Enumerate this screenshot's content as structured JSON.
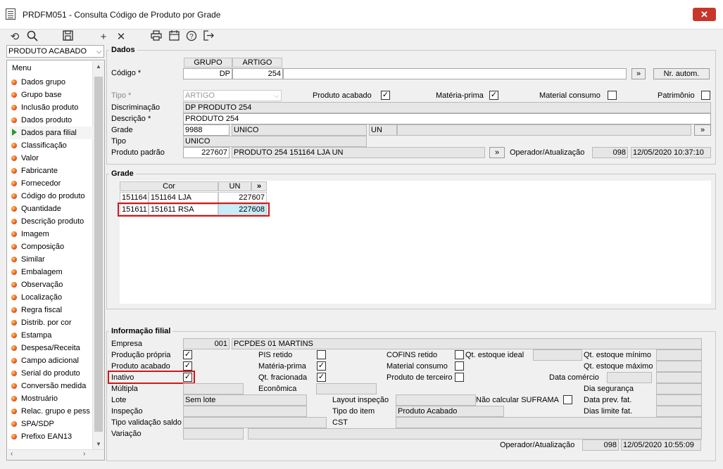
{
  "window": {
    "title": "PRDFM051 - Consulta Código de Produto por Grade",
    "close_glyph": "✕"
  },
  "toolbar": {
    "icons": [
      "undo-icon",
      "search-icon",
      "save-icon",
      "add-icon",
      "delete-icon",
      "print-icon",
      "calendar-icon",
      "help-icon",
      "exit-icon"
    ]
  },
  "sidebar": {
    "selected": "PRODUTO ACABADO",
    "menu_title": "Menu",
    "items": [
      "Dados grupo",
      "Grupo base",
      "Inclusão produto",
      "Dados produto",
      "Dados para filial",
      "Classificação",
      "Valor",
      "Fabricante",
      "Fornecedor",
      "Código do produto",
      "Quantidade",
      "Descrição produto",
      "Imagem",
      "Composição",
      "Similar",
      "Embalagem",
      "Observação",
      "Localização",
      "Regra fiscal",
      "Distrib. por cor",
      "Estampa",
      "Despesa/Receita",
      "Campo adicional",
      "Serial do produto",
      "Conversão medida",
      "Mostruário",
      "Relac. grupo e pess",
      "SPA/SDP",
      "Prefixo EAN13"
    ],
    "active_index": 4
  },
  "dados": {
    "title": "Dados",
    "col_grupo": "GRUPO",
    "col_artigo": "ARTIGO",
    "codigo_label": "Código *",
    "grupo_value": "DP",
    "artigo_value": "254",
    "nr_autom": "Nr. autom.",
    "arrow": "»",
    "tipo_label": "Tipo *",
    "tipo_value": "ARTIGO",
    "produto_acabado": "Produto acabado",
    "materia_prima": "Matéria-prima",
    "material_consumo": "Material consumo",
    "patrimonio": "Patrimônio",
    "discriminacao_label": "Discriminação",
    "discriminacao_value": "DP PRODUTO 254",
    "descricao_label": "Descrição *",
    "descricao_value": "PRODUTO 254",
    "grade_label": "Grade",
    "grade_code": "9988",
    "grade_name": "UNICO",
    "grade_unit": "UN",
    "tipo2_label": "Tipo",
    "tipo2_value": "UNICO",
    "produto_padrao_label": "Produto padrão",
    "produto_padrao_code": "227607",
    "produto_padrao_desc": "PRODUTO 254 151164 LJA UN",
    "operador_label": "Operador/Atualização",
    "operador_code": "098",
    "operador_date": "12/05/2020 10:37:10"
  },
  "grade": {
    "title": "Grade",
    "col_cor": "Cor",
    "col_un": "UN",
    "arrow": "»",
    "rows": [
      {
        "code": "151164",
        "name": "151164 LJA",
        "value": "227607"
      },
      {
        "code": "151611",
        "name": "151611 RSA",
        "value": "227608"
      }
    ]
  },
  "filial": {
    "title": "Informação filial",
    "empresa_label": "Empresa",
    "empresa_code": "001",
    "empresa_name": "PCPDES 01 MARTINS",
    "producao_propria": "Produção própria",
    "produto_acabado": "Produto acabado",
    "inativo": "Inativo",
    "pis_retido": "PIS retido",
    "materia_prima": "Matéria-prima",
    "qt_fracionada": "Qt. fracionada",
    "cofins_retido": "COFINS retido",
    "material_consumo": "Material consumo",
    "produto_terceiro": "Produto de terceiro",
    "qt_estoque_ideal": "Qt. estoque ideal",
    "qt_estoque_minimo": "Qt. estoque mínimo",
    "qt_estoque_maximo": "Qt. estoque máximo",
    "data_comercio": "Data comércio",
    "multipla": "Múltipla",
    "economica": "Econômica",
    "dia_seguranca": "Dia segurança",
    "lote_label": "Lote",
    "lote_value": "Sem lote",
    "layout_inspecao": "Layout inspeção",
    "nao_calcular": "Não calcular SUFRAMA",
    "data_prev_fat": "Data prev. fat.",
    "inspecao": "Inspeção",
    "tipo_item": "Tipo do item",
    "tipo_item_value": "Produto Acabado",
    "dias_limite_fat": "Dias limite fat.",
    "tipo_validacao": "Tipo validação saldo",
    "cst": "CST",
    "variacao": "Variação",
    "operador_label": "Operador/Atualização",
    "operador_code": "098",
    "operador_date": "12/05/2020 10:55:09"
  },
  "colors": {
    "highlight_border": "#d01818",
    "selected_cell": "#c6eef8",
    "active_marker": "#2a9a2a"
  }
}
